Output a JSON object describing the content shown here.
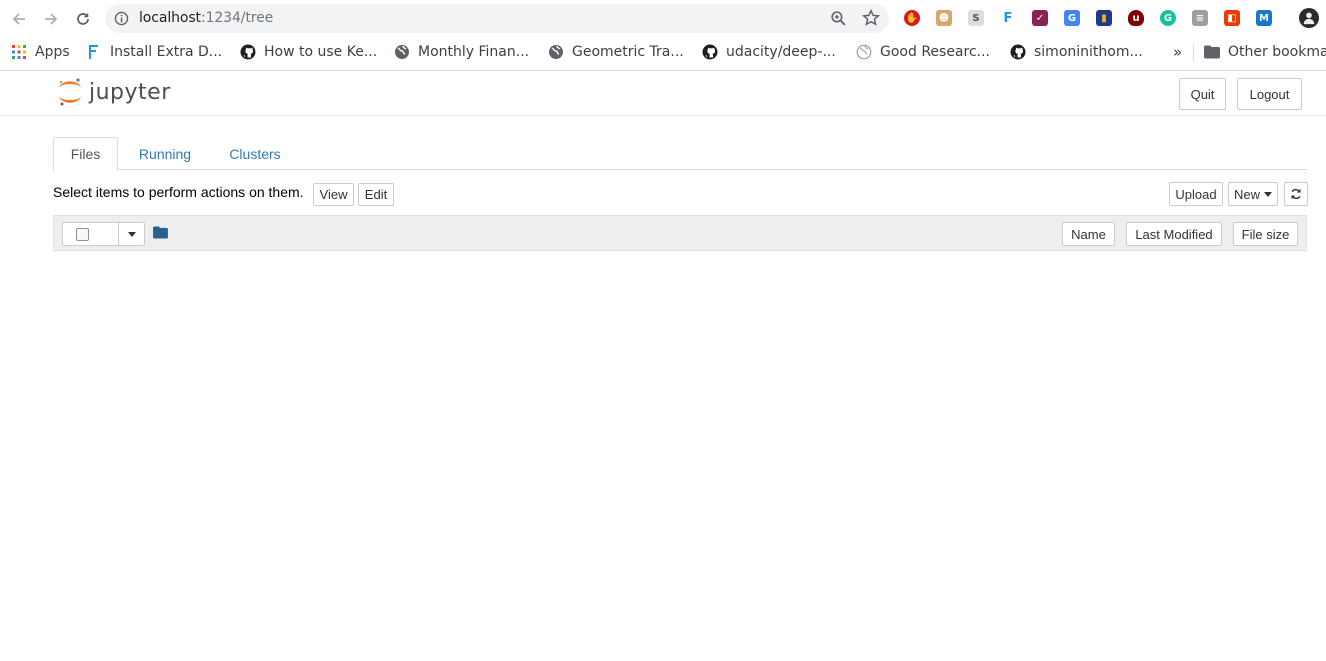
{
  "browser": {
    "url_host": "localhost",
    "url_path": ":1234/tree",
    "extensions": [
      {
        "name": "adblock-icon",
        "color": "#e0161f",
        "glyph": "✋"
      },
      {
        "name": "robot-face-icon",
        "color": "#d9a66b",
        "glyph": "☻"
      },
      {
        "name": "s-letter-icon",
        "color": "#dddddd",
        "glyph": "S"
      },
      {
        "name": "f-letter-icon",
        "color": "#ffffff",
        "glyph": "F"
      },
      {
        "name": "check-grid-icon",
        "color": "#8b2252",
        "glyph": "✓"
      },
      {
        "name": "google-translate-icon",
        "color": "#4285f4",
        "glyph": "G"
      },
      {
        "name": "bar-chart-icon",
        "color": "#1e3a8a",
        "glyph": "▮"
      },
      {
        "name": "ublock-icon",
        "color": "#800000",
        "glyph": "u"
      },
      {
        "name": "grammarly-icon",
        "color": "#15c39a",
        "glyph": "G"
      },
      {
        "name": "reader-icon",
        "color": "#9e9e9e",
        "glyph": "≡"
      },
      {
        "name": "office-icon",
        "color": "#eb3c00",
        "glyph": "◧"
      },
      {
        "name": "m-letter-icon",
        "color": "#1976d2",
        "glyph": "M"
      }
    ]
  },
  "bookmarks": {
    "apps": "Apps",
    "items": [
      {
        "label": "Install Extra D...",
        "icon": "flask-icon"
      },
      {
        "label": "How to use Ke...",
        "icon": "github-icon"
      },
      {
        "label": "Monthly Finan...",
        "icon": "globe-icon"
      },
      {
        "label": "Geometric Tra...",
        "icon": "globe-icon"
      },
      {
        "label": "udacity/deep-...",
        "icon": "github-icon"
      },
      {
        "label": "Good Researc...",
        "icon": "globe-light-icon"
      },
      {
        "label": "simoninithom...",
        "icon": "github-icon"
      }
    ],
    "overflow": "»",
    "other": "Other bookma"
  },
  "header": {
    "logo_text": "jupyter",
    "quit_label": "Quit",
    "logout_label": "Logout"
  },
  "tabs": [
    {
      "label": "Files"
    },
    {
      "label": "Running"
    },
    {
      "label": "Clusters"
    }
  ],
  "toolbar": {
    "select_text": "Select items to perform actions on them.",
    "view_label": "View",
    "edit_label": "Edit",
    "upload_label": "Upload",
    "new_label": "New"
  },
  "list_header": {
    "name_label": "Name",
    "modified_label": "Last Modified",
    "size_label": "File size"
  },
  "colors": {
    "link": "#337ab7",
    "jupyter_orange": "#f37726",
    "folder": "#286090"
  }
}
